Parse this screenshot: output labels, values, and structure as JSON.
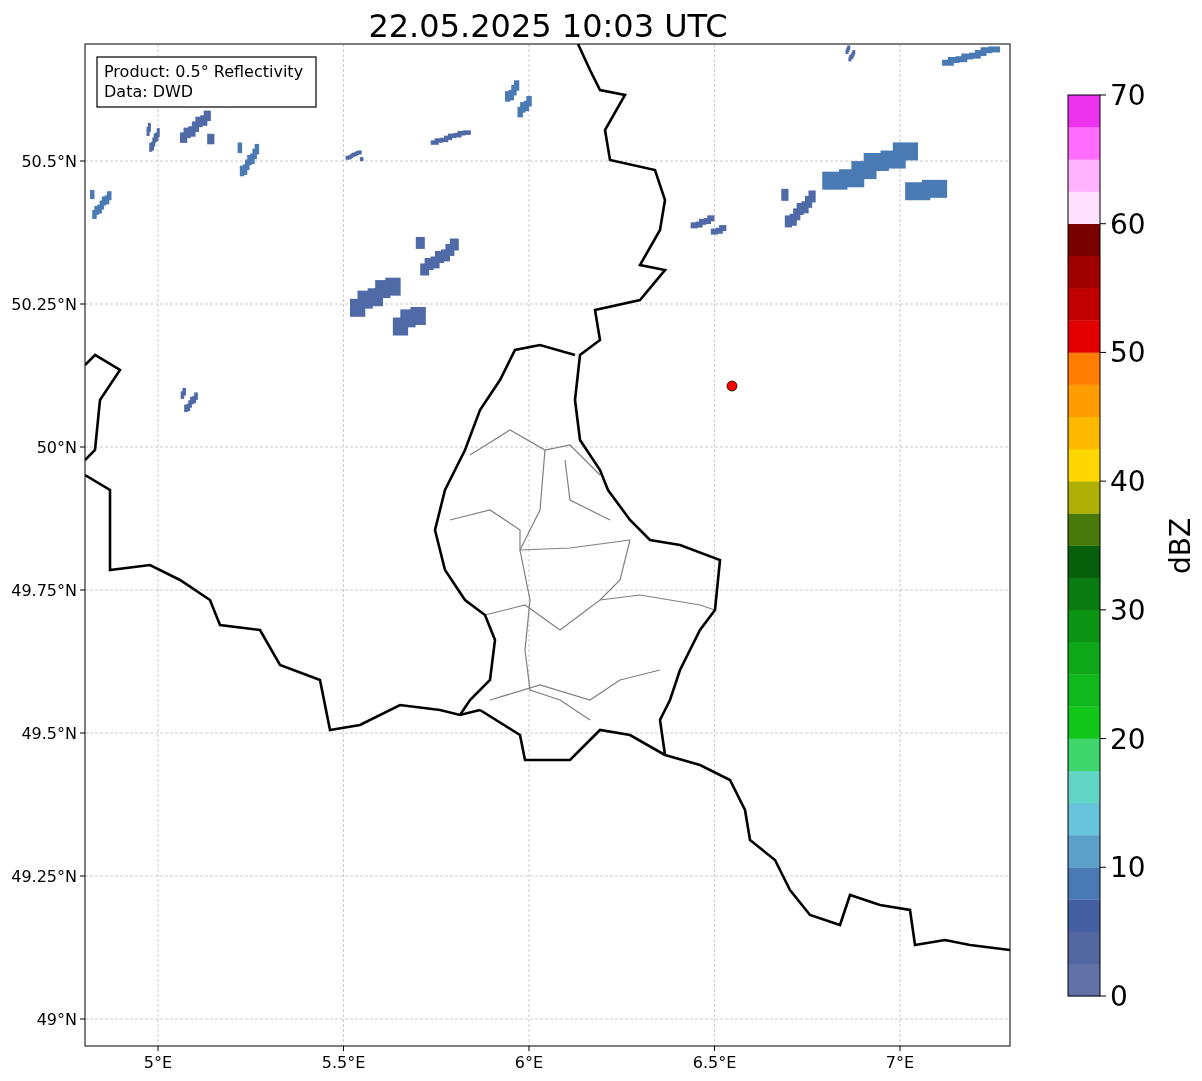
{
  "title": "22.05.2025 10:03 UTC",
  "info_box": [
    "Product: 0.5° Reflectivity",
    "Data: DWD"
  ],
  "lat_ticks": [
    "50.5°N",
    "50.25°N",
    "50°N",
    "49.75°N",
    "49.5°N",
    "49.25°N",
    "49°N"
  ],
  "lon_ticks": [
    "5°E",
    "5.5°E",
    "6°E",
    "6.5°E",
    "7°E"
  ],
  "colorbar": {
    "label": "dBZ",
    "ticks": [
      "70",
      "60",
      "50",
      "40",
      "30",
      "20",
      "10",
      "0"
    ],
    "segments": [
      {
        "color": "#6272a8"
      },
      {
        "color": "#5367a0"
      },
      {
        "color": "#435ea1"
      },
      {
        "color": "#4a7ab3"
      },
      {
        "color": "#5ba0c8"
      },
      {
        "color": "#68c3dc"
      },
      {
        "color": "#62d6c4"
      },
      {
        "color": "#3fd66e"
      },
      {
        "color": "#12c61a"
      },
      {
        "color": "#10b81c"
      },
      {
        "color": "#0ea818"
      },
      {
        "color": "#0c9415"
      },
      {
        "color": "#097b11"
      },
      {
        "color": "#065f0b"
      },
      {
        "color": "#477a0a"
      },
      {
        "color": "#b0b004"
      },
      {
        "color": "#ffd700"
      },
      {
        "color": "#ffb800"
      },
      {
        "color": "#ff9c00"
      },
      {
        "color": "#ff7d00"
      },
      {
        "color": "#e40000"
      },
      {
        "color": "#c00000"
      },
      {
        "color": "#a00000"
      },
      {
        "color": "#7b0000"
      },
      {
        "color": "#ffe0ff"
      },
      {
        "color": "#ffb3ff"
      },
      {
        "color": "#ff6cff"
      },
      {
        "color": "#ee33ee"
      }
    ]
  }
}
